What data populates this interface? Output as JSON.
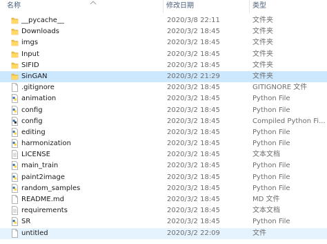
{
  "columns": {
    "name": "名称",
    "date": "修改日期",
    "type": "类型"
  },
  "colors": {
    "selected_row": "#cce8ff",
    "hover_row": "#e5f3ff",
    "folder": "#f0c04a",
    "header_text": "#4c607a"
  },
  "files": [
    {
      "name": "__pycache__",
      "date": "2020/3/8 22:11",
      "type": "文件夹",
      "icon": "folder-icon"
    },
    {
      "name": "Downloads",
      "date": "2020/3/2 18:45",
      "type": "文件夹",
      "icon": "folder-icon"
    },
    {
      "name": "imgs",
      "date": "2020/3/2 18:45",
      "type": "文件夹",
      "icon": "folder-icon"
    },
    {
      "name": "Input",
      "date": "2020/3/2 18:45",
      "type": "文件夹",
      "icon": "folder-icon"
    },
    {
      "name": "SIFID",
      "date": "2020/3/2 18:45",
      "type": "文件夹",
      "icon": "folder-icon"
    },
    {
      "name": "SinGAN",
      "date": "2020/3/2 21:29",
      "type": "文件夹",
      "icon": "folder-icon",
      "state": "selected"
    },
    {
      "name": ".gitignore",
      "date": "2020/3/2 18:45",
      "type": "GITIGNORE 文件",
      "icon": "blank-file-icon"
    },
    {
      "name": "animation",
      "date": "2020/3/2 18:45",
      "type": "Python File",
      "icon": "python-file-icon"
    },
    {
      "name": "config",
      "date": "2020/3/2 18:45",
      "type": "Python File",
      "icon": "python-file-icon"
    },
    {
      "name": "config",
      "date": "2020/3/2 18:45",
      "type": "Compiled Python Fi...",
      "icon": "compiled-python-icon"
    },
    {
      "name": "editing",
      "date": "2020/3/2 18:45",
      "type": "Python File",
      "icon": "python-file-icon"
    },
    {
      "name": "harmonization",
      "date": "2020/3/2 18:45",
      "type": "Python File",
      "icon": "python-file-icon"
    },
    {
      "name": "LICENSE",
      "date": "2020/3/2 18:45",
      "type": "文本文档",
      "icon": "text-file-icon"
    },
    {
      "name": "main_train",
      "date": "2020/3/2 18:45",
      "type": "Python File",
      "icon": "python-file-icon"
    },
    {
      "name": "paint2image",
      "date": "2020/3/2 18:45",
      "type": "Python File",
      "icon": "python-file-icon"
    },
    {
      "name": "random_samples",
      "date": "2020/3/2 18:45",
      "type": "Python File",
      "icon": "python-file-icon"
    },
    {
      "name": "README.md",
      "date": "2020/3/2 18:45",
      "type": "MD 文件",
      "icon": "blank-file-icon"
    },
    {
      "name": "requirements",
      "date": "2020/3/2 18:45",
      "type": "文本文档",
      "icon": "text-file-icon"
    },
    {
      "name": "SR",
      "date": "2020/3/2 18:45",
      "type": "Python File",
      "icon": "python-file-icon"
    },
    {
      "name": "untitled",
      "date": "2020/3/2 22:09",
      "type": "文件",
      "icon": "blank-file-icon",
      "state": "hover"
    }
  ]
}
